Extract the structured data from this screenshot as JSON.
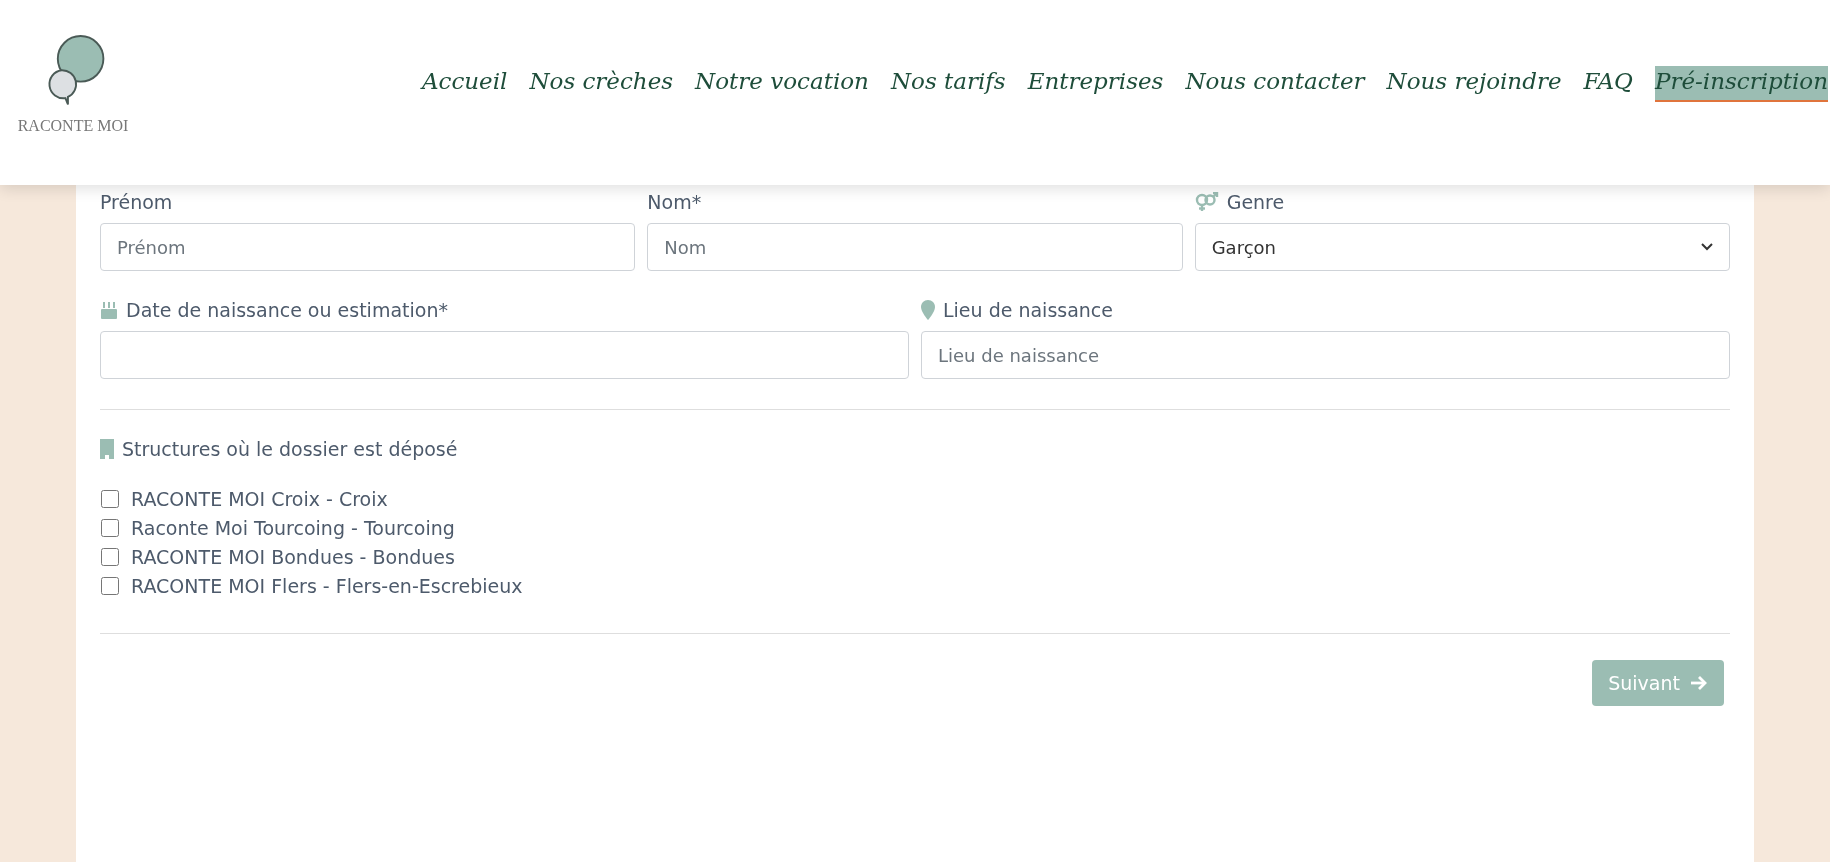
{
  "logo": {
    "text": "RACONTE MOI"
  },
  "nav": [
    {
      "label": "Accueil",
      "selected": false
    },
    {
      "label": "Nos crèches",
      "selected": false
    },
    {
      "label": "Notre vocation",
      "selected": false
    },
    {
      "label": "Nos tarifs",
      "selected": false
    },
    {
      "label": "Entreprises",
      "selected": false
    },
    {
      "label": "Nous contacter",
      "selected": false
    },
    {
      "label": "Nous rejoindre",
      "selected": false
    },
    {
      "label": "FAQ",
      "selected": false
    },
    {
      "label": "Pré-inscription",
      "selected": true
    }
  ],
  "row_1": [
    {
      "kind": "text",
      "label": "Prénom",
      "placeholder": "Prénom"
    },
    {
      "kind": "text",
      "label": "Nom*",
      "placeholder": "Nom"
    },
    {
      "kind": "select",
      "label": "Genre",
      "value": "Garçon"
    }
  ],
  "row_2": [
    {
      "kind": "text",
      "label": "Date de naissance ou estimation*"
    },
    {
      "kind": "text",
      "label": "Lieu de naissance",
      "placeholder": "Lieu de naissance"
    }
  ],
  "structures": {
    "label": "Structures où le dossier est déposé",
    "options": [
      {
        "label": "RACONTE MOI Croix - Croix",
        "checked": false
      },
      {
        "label": "Raconte Moi Tourcoing - Tourcoing",
        "checked": false
      },
      {
        "label": "RACONTE MOI Bondues - Bondues",
        "checked": false
      },
      {
        "label": "RACONTE MOI Flers - Flers-en-Escrebieux",
        "checked": false
      }
    ]
  },
  "next_button": {
    "label": "Suivant"
  }
}
